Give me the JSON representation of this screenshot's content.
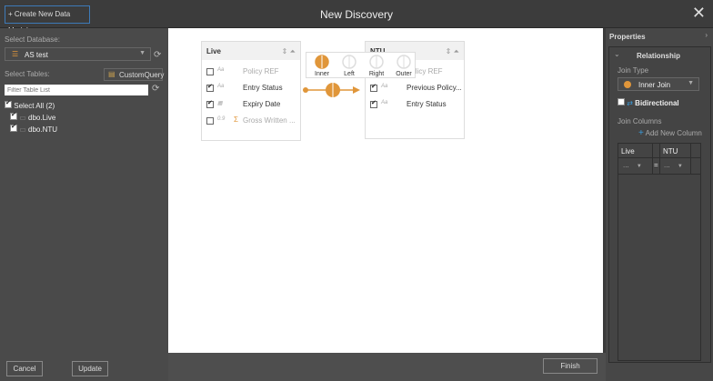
{
  "header": {
    "create_label": "+ Create New Data Model",
    "title": "New Discovery"
  },
  "left": {
    "select_db_label": "Select Database:",
    "database": "AS test",
    "select_tables_label": "Select Tables:",
    "custom_query_label": "CustomQuery",
    "filter_placeholder": "Filter Table List",
    "select_all_label": "Select All (2)",
    "tables": [
      {
        "name": "dbo.Live",
        "checked": true
      },
      {
        "name": "dbo.NTU",
        "checked": true
      }
    ],
    "cancel_label": "Cancel",
    "update_label": "Update"
  },
  "canvas": {
    "live": {
      "title": "Live",
      "fields": [
        {
          "type": "Aa",
          "name": "Policy REF",
          "checked": false
        },
        {
          "type": "Aa",
          "name": "Entry Status",
          "checked": true
        },
        {
          "type": "▦",
          "name": "Expiry Date",
          "checked": true
        },
        {
          "type": "0.9",
          "name": "Gross Written ...",
          "checked": false
        }
      ]
    },
    "ntu": {
      "title": "NTU",
      "fields": [
        {
          "type": "Aa",
          "name": "Policy REF",
          "checked": false
        },
        {
          "type": "Aa",
          "name": "Previous Policy...",
          "checked": true
        },
        {
          "type": "Aa",
          "name": "Entry Status",
          "checked": true
        }
      ]
    },
    "join_options": [
      "Inner",
      "Left",
      "Right",
      "Outer"
    ],
    "selected_join": "Inner",
    "accent": "#e0963a"
  },
  "finish_label": "Finish",
  "properties": {
    "title": "Properties",
    "section": "Relationship",
    "join_type_label": "Join Type",
    "join_type": "Inner Join",
    "bidirectional_label": "Bidirectional",
    "join_columns_label": "Join Columns",
    "add_column_label": "Add New Column",
    "col_left": "Live",
    "col_right": "NTU",
    "left_value": "...",
    "eq": "=",
    "right_value": "..."
  }
}
